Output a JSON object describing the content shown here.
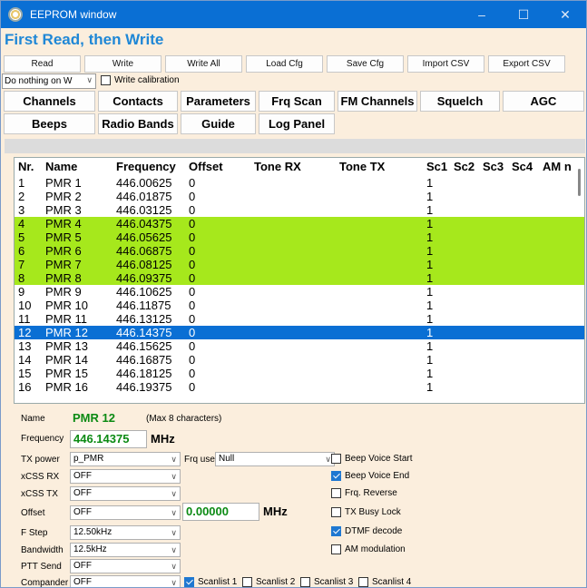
{
  "window": {
    "title": "EEPROM window",
    "controls": [
      "–",
      "☐",
      "✕"
    ]
  },
  "headline": "First Read, then Write",
  "toolbar": {
    "buttons": [
      "Read",
      "Write",
      "Write All",
      "Load Cfg",
      "Save Cfg",
      "Import CSV",
      "Export CSV"
    ],
    "select_value": "Do nothing on W",
    "write_calibration": "Write calibration"
  },
  "tabs_row1": [
    "Channels",
    "Contacts",
    "Parameters",
    "Frq Scan",
    "FM Channels",
    "Squelch",
    "AGC"
  ],
  "tabs_row2": [
    "Beeps",
    "Radio Bands",
    "Guide",
    "Log Panel"
  ],
  "table": {
    "headers": [
      "Nr.",
      "Name",
      "Frequency",
      "Offset",
      "Tone RX",
      "Tone TX",
      "Sc1",
      "Sc2",
      "Sc3",
      "Sc4",
      "AM n"
    ],
    "rows": [
      {
        "nr": "1",
        "name": "PMR 1",
        "freq": "446.00625",
        "offset": "0",
        "sc1": "1",
        "style": ""
      },
      {
        "nr": "2",
        "name": "PMR 2",
        "freq": "446.01875",
        "offset": "0",
        "sc1": "1",
        "style": ""
      },
      {
        "nr": "3",
        "name": "PMR 3",
        "freq": "446.03125",
        "offset": "0",
        "sc1": "1",
        "style": ""
      },
      {
        "nr": "4",
        "name": "PMR 4",
        "freq": "446.04375",
        "offset": "0",
        "sc1": "1",
        "style": "hl"
      },
      {
        "nr": "5",
        "name": "PMR 5",
        "freq": "446.05625",
        "offset": "0",
        "sc1": "1",
        "style": "hl"
      },
      {
        "nr": "6",
        "name": "PMR 6",
        "freq": "446.06875",
        "offset": "0",
        "sc1": "1",
        "style": "hl"
      },
      {
        "nr": "7",
        "name": "PMR 7",
        "freq": "446.08125",
        "offset": "0",
        "sc1": "1",
        "style": "hl"
      },
      {
        "nr": "8",
        "name": "PMR 8",
        "freq": "446.09375",
        "offset": "0",
        "sc1": "1",
        "style": "hl"
      },
      {
        "nr": "9",
        "name": "PMR 9",
        "freq": "446.10625",
        "offset": "0",
        "sc1": "1",
        "style": ""
      },
      {
        "nr": "10",
        "name": "PMR 10",
        "freq": "446.11875",
        "offset": "0",
        "sc1": "1",
        "style": ""
      },
      {
        "nr": "11",
        "name": "PMR 11",
        "freq": "446.13125",
        "offset": "0",
        "sc1": "1",
        "style": ""
      },
      {
        "nr": "12",
        "name": "PMR 12",
        "freq": "446.14375",
        "offset": "0",
        "sc1": "1",
        "style": "sel"
      },
      {
        "nr": "13",
        "name": "PMR 13",
        "freq": "446.15625",
        "offset": "0",
        "sc1": "1",
        "style": ""
      },
      {
        "nr": "14",
        "name": "PMR 14",
        "freq": "446.16875",
        "offset": "0",
        "sc1": "1",
        "style": ""
      },
      {
        "nr": "15",
        "name": "PMR 15",
        "freq": "446.18125",
        "offset": "0",
        "sc1": "1",
        "style": ""
      },
      {
        "nr": "16",
        "name": "PMR 16",
        "freq": "446.19375",
        "offset": "0",
        "sc1": "1",
        "style": ""
      }
    ]
  },
  "details": {
    "name_label": "Name",
    "name_value": "PMR 12",
    "name_hint": "(Max 8 characters)",
    "frequency_label": "Frequency",
    "frequency_value": "446.14375",
    "frequency_unit": "MHz",
    "tx_power_label": "TX power",
    "tx_power_value": "p_PMR",
    "frq_use_label": "Frq use",
    "frq_use_value": "Null",
    "xcss_rx_label": "xCSS RX",
    "xcss_rx_value": "OFF",
    "xcss_tx_label": "xCSS TX",
    "xcss_tx_value": "OFF",
    "offset_label": "Offset",
    "offset_value": "OFF",
    "offset_mhz_value": "0.00000",
    "offset_unit": "MHz",
    "fstep_label": "F Step",
    "fstep_value": "12.50kHz",
    "bandwidth_label": "Bandwidth",
    "bandwidth_value": "12.5kHz",
    "ptt_label": "PTT Send",
    "ptt_value": "OFF",
    "compander_label": "Compander",
    "compander_value": "OFF",
    "checkboxes": [
      {
        "label": "Beep Voice Start",
        "checked": false
      },
      {
        "label": "Beep Voice End",
        "checked": true
      },
      {
        "label": "Frq. Reverse",
        "checked": false
      },
      {
        "label": "TX Busy Lock",
        "checked": false
      },
      {
        "label": "DTMF decode",
        "checked": true
      },
      {
        "label": "AM modulation",
        "checked": false
      }
    ],
    "scanlists": [
      {
        "label": "Scanlist 1",
        "checked": true
      },
      {
        "label": "Scanlist 2",
        "checked": false
      },
      {
        "label": "Scanlist 3",
        "checked": false
      },
      {
        "label": "Scanlist 4",
        "checked": false
      }
    ]
  },
  "colors": {
    "title_bar": "#0a6fd4",
    "headline": "#1f87d6",
    "row_highlight": "#a6e81c",
    "row_selected": "#0a6fd4",
    "value_green": "#0b8a13"
  }
}
